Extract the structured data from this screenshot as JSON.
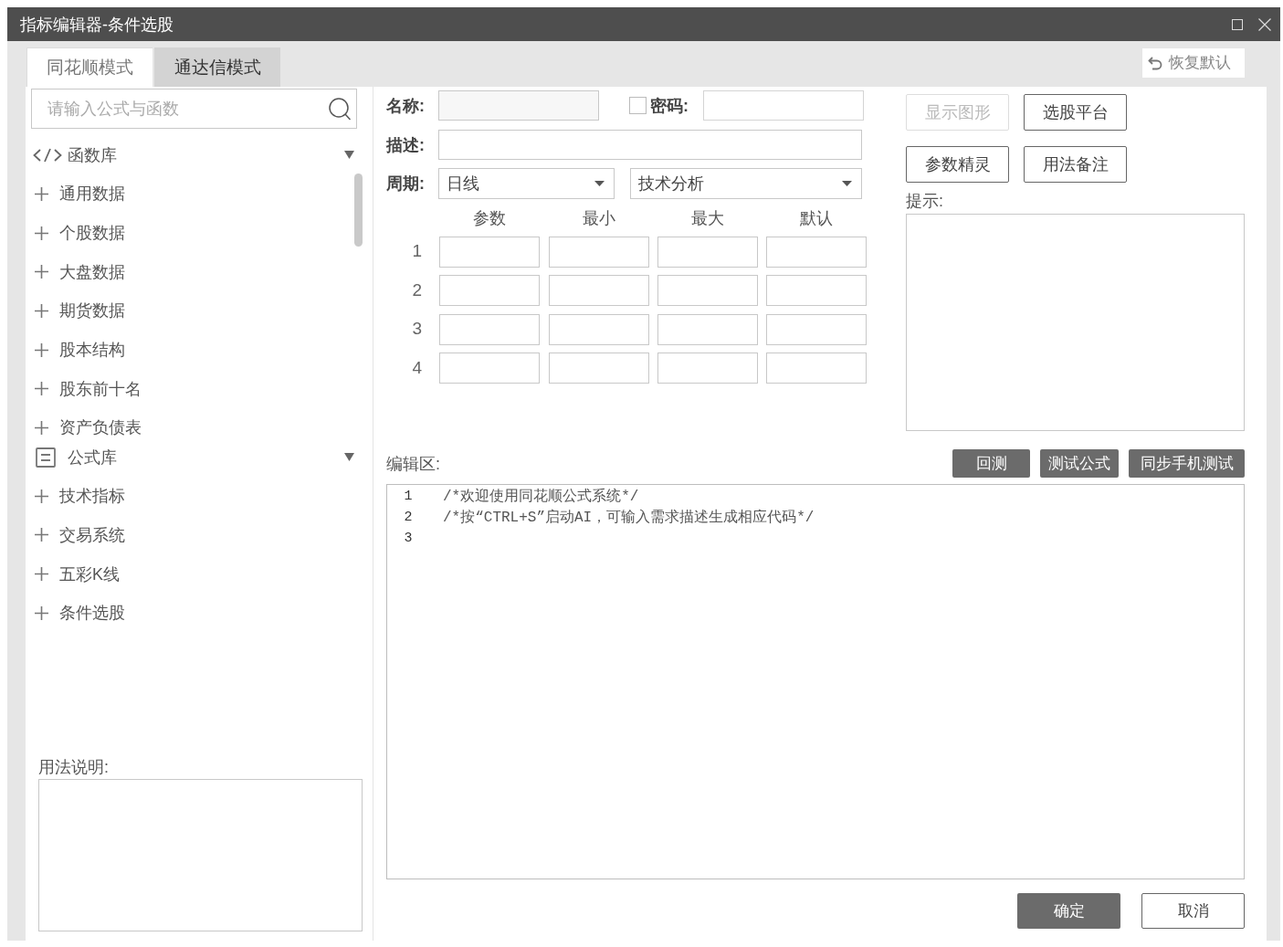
{
  "window": {
    "title": "指标编辑器-条件选股"
  },
  "tabs": [
    {
      "label": "同花顺模式",
      "selected": true
    },
    {
      "label": "通达信模式",
      "selected": false
    }
  ],
  "restore_button": {
    "label": "恢复默认"
  },
  "sidebar": {
    "search": {
      "placeholder": "请输入公式与函数"
    },
    "groups": [
      {
        "kind": "code",
        "label": "函数库",
        "expanded": true,
        "children": [
          {
            "label": "通用数据",
            "expanded": false
          },
          {
            "label": "个股数据",
            "expanded": false
          },
          {
            "label": "大盘数据",
            "expanded": false
          },
          {
            "label": "期货数据",
            "expanded": false
          },
          {
            "label": "股本结构",
            "expanded": false
          },
          {
            "label": "股东前十名",
            "expanded": false
          },
          {
            "label": "资产负债表",
            "expanded": false
          }
        ]
      },
      {
        "kind": "list",
        "label": "公式库",
        "expanded": true,
        "children": [
          {
            "label": "技术指标",
            "expanded": false
          },
          {
            "label": "交易系统",
            "expanded": false
          },
          {
            "label": "五彩K线",
            "expanded": false
          },
          {
            "label": "条件选股",
            "expanded": false
          }
        ]
      }
    ],
    "usage": {
      "label": "用法说明:"
    }
  },
  "form": {
    "name": {
      "label": "名称:"
    },
    "password": {
      "label": "密码:",
      "checked": false
    },
    "description": {
      "label": "描述:"
    },
    "period": {
      "label": "周期:",
      "value": "日线"
    },
    "category": {
      "value": "技术分析"
    },
    "params": {
      "columns": [
        "参数",
        "最小",
        "最大",
        "默认"
      ],
      "rows": [
        {
          "label": "1"
        },
        {
          "label": "2"
        },
        {
          "label": "3"
        },
        {
          "label": "4"
        }
      ]
    }
  },
  "side_buttons": [
    {
      "label": "显示图形",
      "disabled": true
    },
    {
      "label": "选股平台",
      "disabled": false
    },
    {
      "label": "参数精灵",
      "disabled": false
    },
    {
      "label": "用法备注",
      "disabled": false
    }
  ],
  "hint": {
    "label": "提示:"
  },
  "editor": {
    "label": "编辑区:",
    "buttons": [
      "回测",
      "测试公式",
      "同步手机测试"
    ],
    "lines": [
      {
        "number": "1",
        "text": "/*欢迎使用同花顺公式系统*/"
      },
      {
        "number": "2",
        "text": "/*按“CTRL+S”启动AI，可输入需求描述生成相应代码*/"
      },
      {
        "number": "3"
      }
    ]
  },
  "footer": {
    "buttons": [
      {
        "label": "确定",
        "kind": "primary"
      },
      {
        "label": "取消",
        "kind": "secondary"
      }
    ]
  }
}
